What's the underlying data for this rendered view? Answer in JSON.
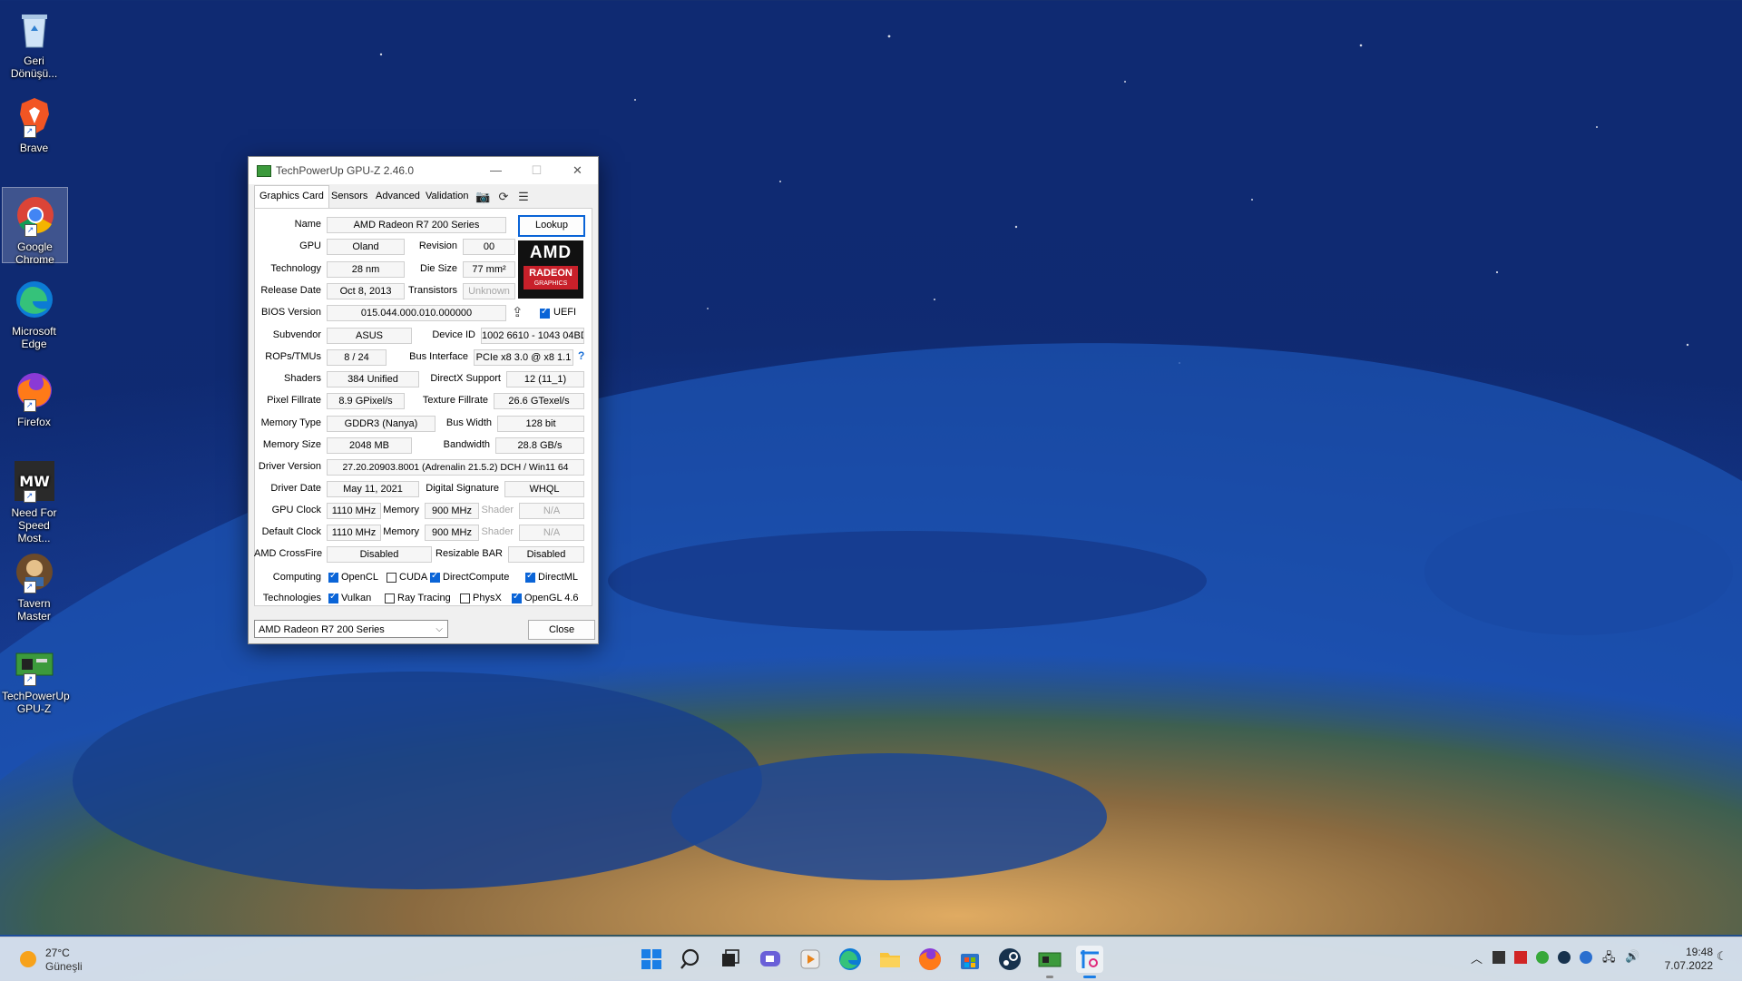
{
  "desktop": {
    "icons": [
      {
        "label": "Geri Dönüşü...",
        "icon": "recycle-bin-icon"
      },
      {
        "label": "Brave",
        "icon": "brave-icon"
      },
      {
        "label": "Google Chrome",
        "icon": "chrome-icon"
      },
      {
        "label": "Microsoft Edge",
        "icon": "edge-icon"
      },
      {
        "label": "Firefox",
        "icon": "firefox-icon"
      },
      {
        "label": "Need For Speed Most...",
        "icon": "nfs-icon"
      },
      {
        "label": "Tavern Master",
        "icon": "tavern-master-icon"
      },
      {
        "label": "TechPowerUp GPU-Z",
        "icon": "gpuz-icon"
      }
    ]
  },
  "window": {
    "title": "TechPowerUp GPU-Z 2.46.0",
    "tabs": [
      "Graphics Card",
      "Sensors",
      "Advanced",
      "Validation"
    ],
    "lookup_label": "Lookup",
    "close_label": "Close",
    "selected_card": "AMD Radeon R7 200 Series",
    "logo_text": {
      "brand": "AMD",
      "line1": "RADEON",
      "line2": "GRAPHICS"
    },
    "fields": {
      "name": {
        "label": "Name",
        "value": "AMD Radeon R7 200 Series"
      },
      "gpu": {
        "label": "GPU",
        "value": "Oland"
      },
      "revision": {
        "label": "Revision",
        "value": "00"
      },
      "technology": {
        "label": "Technology",
        "value": "28 nm"
      },
      "die_size": {
        "label": "Die Size",
        "value": "77 mm²"
      },
      "release_date": {
        "label": "Release Date",
        "value": "Oct 8, 2013"
      },
      "transistors": {
        "label": "Transistors",
        "value": "Unknown"
      },
      "bios_version": {
        "label": "BIOS Version",
        "value": "015.044.000.010.000000"
      },
      "uefi": {
        "label": "UEFI",
        "checked": true
      },
      "subvendor": {
        "label": "Subvendor",
        "value": "ASUS"
      },
      "device_id": {
        "label": "Device ID",
        "value": "1002 6610 - 1043 04BD"
      },
      "rops_tmus": {
        "label": "ROPs/TMUs",
        "value": "8 / 24"
      },
      "bus_interface": {
        "label": "Bus Interface",
        "value": "PCIe x8 3.0 @ x8 1.1"
      },
      "bus_help": "?",
      "shaders": {
        "label": "Shaders",
        "value": "384 Unified"
      },
      "directx": {
        "label": "DirectX Support",
        "value": "12 (11_1)"
      },
      "pixel_fillrate": {
        "label": "Pixel Fillrate",
        "value": "8.9 GPixel/s"
      },
      "texture_fillrate": {
        "label": "Texture Fillrate",
        "value": "26.6 GTexel/s"
      },
      "memory_type": {
        "label": "Memory Type",
        "value": "GDDR3 (Nanya)"
      },
      "bus_width": {
        "label": "Bus Width",
        "value": "128 bit"
      },
      "memory_size": {
        "label": "Memory Size",
        "value": "2048 MB"
      },
      "bandwidth": {
        "label": "Bandwidth",
        "value": "28.8 GB/s"
      },
      "driver_version": {
        "label": "Driver Version",
        "value": "27.20.20903.8001 (Adrenalin 21.5.2) DCH / Win11 64"
      },
      "driver_date": {
        "label": "Driver Date",
        "value": "May 11, 2021"
      },
      "digital_signature": {
        "label": "Digital Signature",
        "value": "WHQL"
      },
      "gpu_clock": {
        "label": "GPU Clock",
        "value": "1110 MHz",
        "mem_label": "Memory",
        "mem_value": "900 MHz",
        "shader_label": "Shader",
        "shader_value": "N/A"
      },
      "default_clock": {
        "label": "Default Clock",
        "value": "1110 MHz",
        "mem_label": "Memory",
        "mem_value": "900 MHz",
        "shader_label": "Shader",
        "shader_value": "N/A"
      },
      "crossfire": {
        "label": "AMD CrossFire",
        "value": "Disabled"
      },
      "resizable_bar": {
        "label": "Resizable BAR",
        "value": "Disabled"
      }
    },
    "computing": {
      "label": "Computing",
      "items": [
        {
          "name": "OpenCL",
          "checked": true
        },
        {
          "name": "CUDA",
          "checked": false
        },
        {
          "name": "DirectCompute",
          "checked": true
        },
        {
          "name": "DirectML",
          "checked": true
        }
      ]
    },
    "technologies": {
      "label": "Technologies",
      "items": [
        {
          "name": "Vulkan",
          "checked": true
        },
        {
          "name": "Ray Tracing",
          "checked": false
        },
        {
          "name": "PhysX",
          "checked": false
        },
        {
          "name": "OpenGL 4.6",
          "checked": true
        }
      ]
    }
  },
  "taskbar": {
    "weather": {
      "temp": "27°C",
      "condition": "Güneşli"
    },
    "apps": [
      "start-icon",
      "search-icon",
      "task-view-icon",
      "chat-icon",
      "media-icon",
      "edge-icon",
      "file-explorer-icon",
      "firefox-icon",
      "store-icon",
      "steam-icon",
      "gpuz-icon",
      "snipping-tool-icon"
    ],
    "clock": {
      "time": "19:48",
      "date": "7.07.2022"
    }
  },
  "colors": {
    "accent": "#0a64d7",
    "amd_red": "#c8202a"
  }
}
